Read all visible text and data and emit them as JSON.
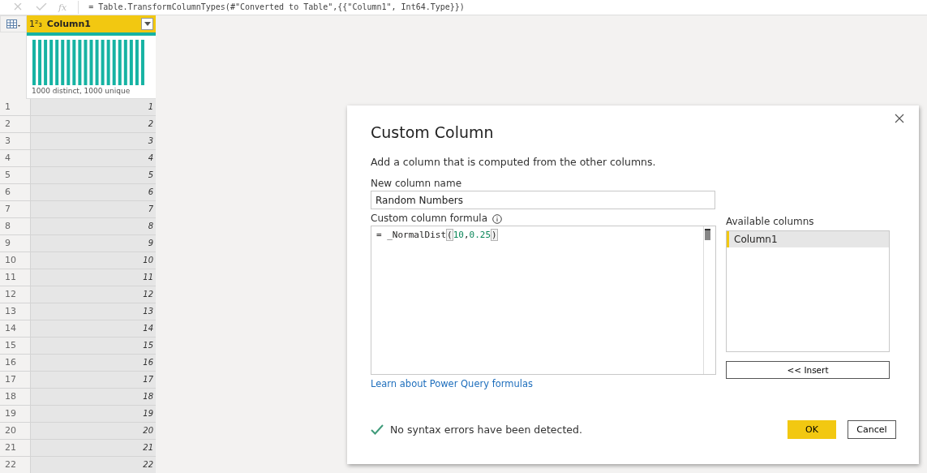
{
  "formula_bar": {
    "fx_label": "fx",
    "formula": "= Table.TransformColumnTypes(#\"Converted to Table\",{{\"Column1\", Int64.Type}})"
  },
  "table": {
    "columns": [
      {
        "type_label": "1²₃",
        "name": "Column1",
        "profile": "1000 distinct, 1000 unique"
      }
    ],
    "rows": [
      {
        "num": "1",
        "value": "1"
      },
      {
        "num": "2",
        "value": "2"
      },
      {
        "num": "3",
        "value": "3"
      },
      {
        "num": "4",
        "value": "4"
      },
      {
        "num": "5",
        "value": "5"
      },
      {
        "num": "6",
        "value": "6"
      },
      {
        "num": "7",
        "value": "7"
      },
      {
        "num": "8",
        "value": "8"
      },
      {
        "num": "9",
        "value": "9"
      },
      {
        "num": "10",
        "value": "10"
      },
      {
        "num": "11",
        "value": "11"
      },
      {
        "num": "12",
        "value": "12"
      },
      {
        "num": "13",
        "value": "13"
      },
      {
        "num": "14",
        "value": "14"
      },
      {
        "num": "15",
        "value": "15"
      },
      {
        "num": "16",
        "value": "16"
      },
      {
        "num": "17",
        "value": "17"
      },
      {
        "num": "18",
        "value": "18"
      },
      {
        "num": "19",
        "value": "19"
      },
      {
        "num": "20",
        "value": "20"
      },
      {
        "num": "21",
        "value": "21"
      },
      {
        "num": "22",
        "value": "22"
      }
    ]
  },
  "dialog": {
    "title": "Custom Column",
    "description": "Add a column that is computed from the other columns.",
    "name_label": "New column name",
    "name_value": "Random Numbers",
    "formula_label": "Custom column formula",
    "formula_tokens": [
      {
        "kind": "plain",
        "text": "= _NormalDist"
      },
      {
        "kind": "bracket",
        "text": "("
      },
      {
        "kind": "number",
        "text": "10"
      },
      {
        "kind": "plain",
        "text": ","
      },
      {
        "kind": "number",
        "text": "0.25"
      },
      {
        "kind": "bracket",
        "text": ")"
      }
    ],
    "columns_label": "Available columns",
    "available_columns": [
      {
        "name": "Column1",
        "selected": true
      }
    ],
    "insert_button": "<< Insert",
    "learn_link": "Learn about Power Query formulas",
    "status": "No syntax errors have been detected.",
    "ok_button": "OK",
    "cancel_button": "Cancel"
  }
}
